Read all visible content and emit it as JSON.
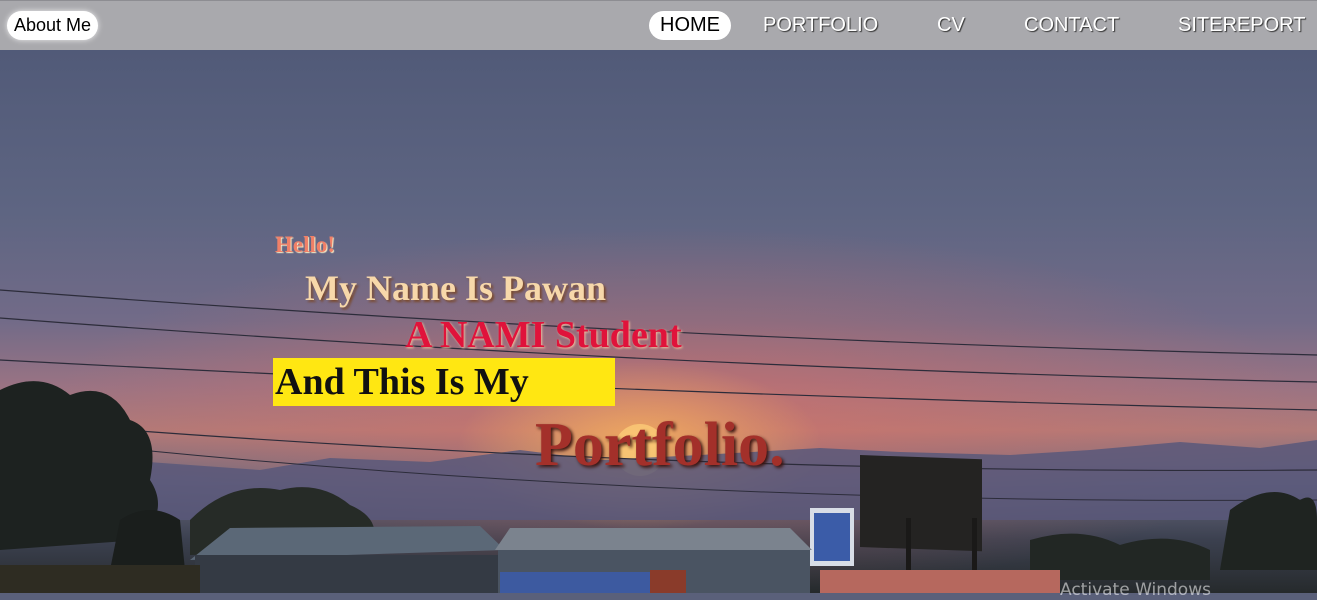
{
  "nav": {
    "brand": "About Me",
    "links": [
      {
        "label": "HOME",
        "active": true
      },
      {
        "label": "PORTFOLIO",
        "active": false
      },
      {
        "label": "CV",
        "active": false
      },
      {
        "label": "CONTACT",
        "active": false
      },
      {
        "label": "SITEREPORT",
        "active": false
      }
    ]
  },
  "hero": {
    "greeting": "Hello!",
    "name_line": "My Name Is Pawan",
    "student_line": "A NAMI Student",
    "my_line": "And This Is My",
    "portfolio_word": "Portfolio."
  },
  "system": {
    "watermark": "Activate Windows"
  },
  "colors": {
    "navbar_bg": "#a9a9ad",
    "highlight_yellow": "#ffe712",
    "student_red": "#e0133b",
    "portfolio_red": "#a3302a"
  }
}
